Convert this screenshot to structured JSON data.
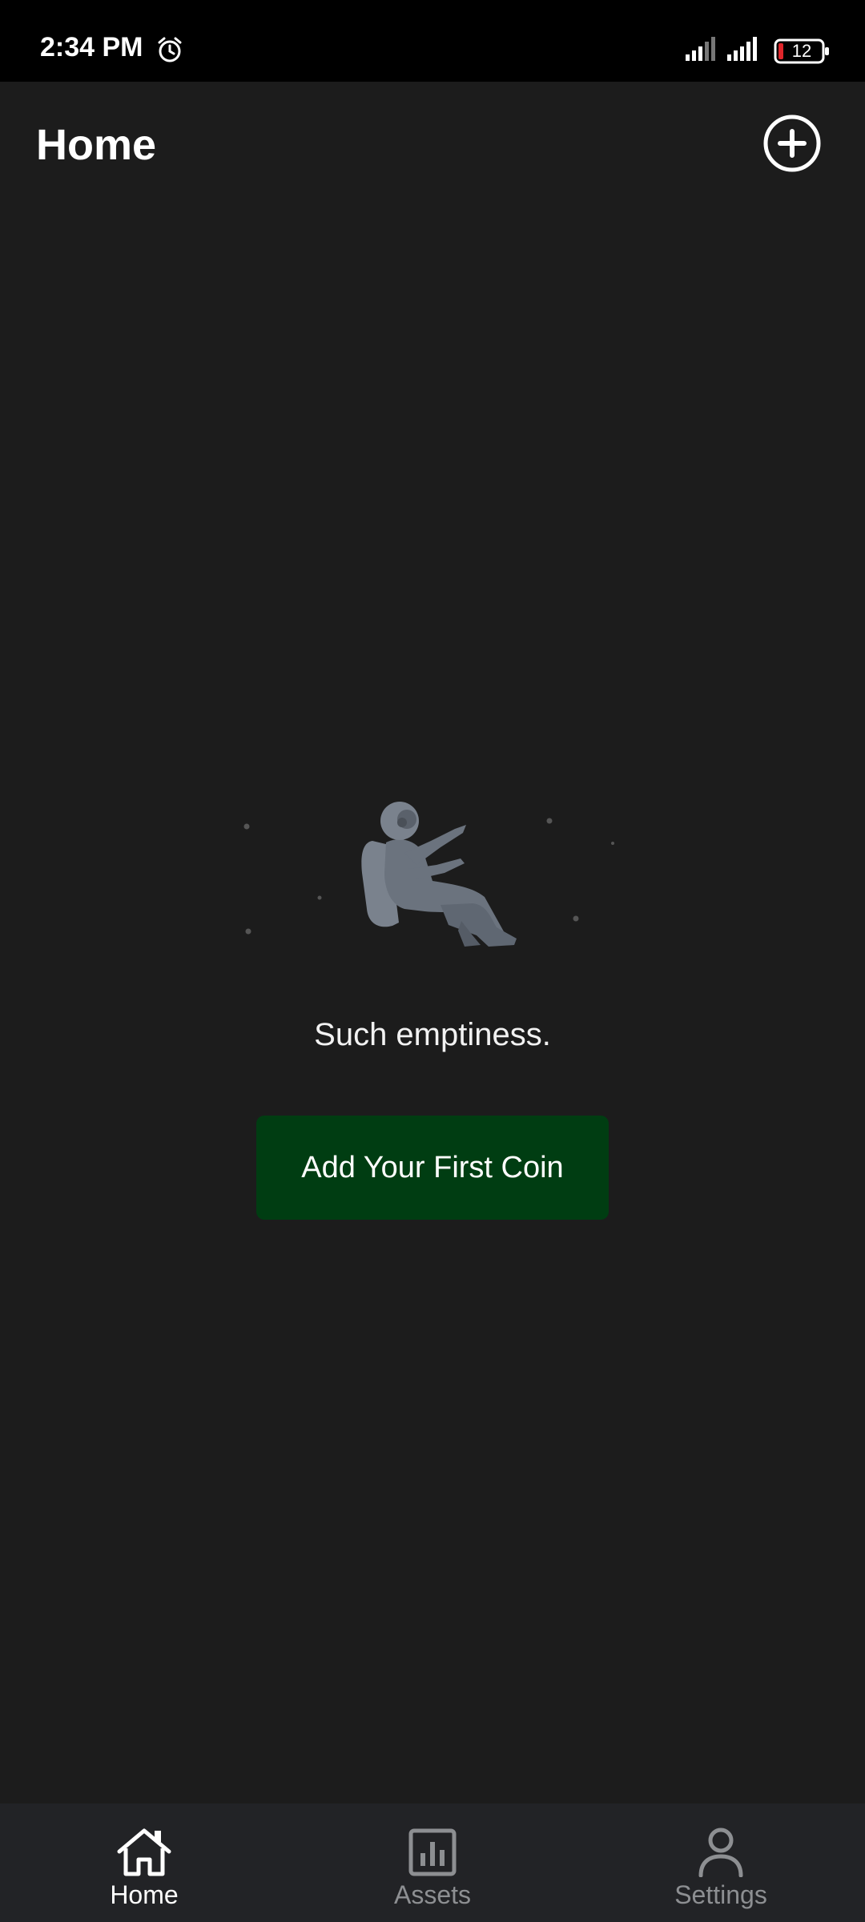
{
  "status_bar": {
    "time": "2:34 PM",
    "battery_level": "12",
    "icons": [
      "alarm-icon",
      "signal-icon",
      "signal-icon",
      "battery-icon"
    ]
  },
  "header": {
    "title": "Home",
    "add_icon": "plus-circle-icon"
  },
  "empty_state": {
    "illustration": "floating-astronaut",
    "message": "Such emptiness.",
    "cta_label": "Add Your First Coin"
  },
  "bottom_nav": {
    "items": [
      {
        "label": "Home",
        "icon": "home-icon",
        "active": true
      },
      {
        "label": "Assets",
        "icon": "bar-chart-icon",
        "active": false
      },
      {
        "label": "Settings",
        "icon": "user-icon",
        "active": false
      }
    ]
  },
  "colors": {
    "background": "#1c1c1c",
    "status_bar": "#000000",
    "nav_background": "#222326",
    "cta_background": "#003d12",
    "inactive": "#8d8f92",
    "battery_low": "#e0262b"
  }
}
